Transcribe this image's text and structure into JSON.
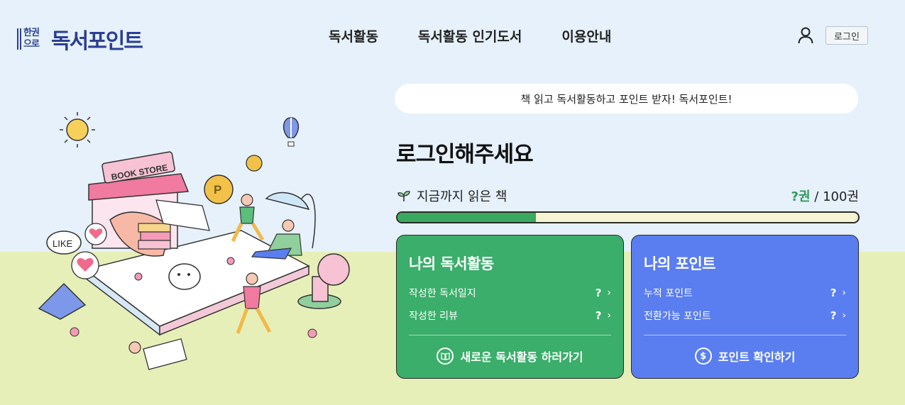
{
  "header": {
    "logo_small_top": "한권",
    "logo_small_bottom": "으로",
    "logo_text": "독서포인트",
    "nav": [
      "독서활동",
      "독서활동 인기도서",
      "이용안내"
    ],
    "login_label": "로그인"
  },
  "hero": {
    "slogan": "책 읽고 독서활동하고 포인트 받자! 독서포인트!",
    "login_prompt": "로그인해주세요",
    "books_read_label": "지금까지 읽은 책",
    "books_count_value": "?권",
    "books_count_total": " / 100권",
    "progress_fraction": 0.3,
    "illustration_text": {
      "store_sign": "BOOK STORE",
      "like_bubble": "LIKE"
    }
  },
  "activity_card": {
    "title": "나의 독서활동",
    "rows": [
      {
        "label": "작성한 독서일지",
        "value": "?"
      },
      {
        "label": "작성한 리뷰",
        "value": "?"
      }
    ],
    "action": "새로운 독서활동 하러가기",
    "icon": "book-icon"
  },
  "points_card": {
    "title": "나의 포인트",
    "rows": [
      {
        "label": "누적 포인트",
        "value": "?"
      },
      {
        "label": "전환가능 포인트",
        "value": "?"
      }
    ],
    "action": "포인트 확인하기",
    "icon": "dollar-icon"
  },
  "colors": {
    "brand": "#2b3f93",
    "green_card": "#3aae6a",
    "blue_card": "#5a7ef0",
    "progress_fill": "#38a95f",
    "sky": "#e6f1fb",
    "ground": "#e7efb8"
  }
}
